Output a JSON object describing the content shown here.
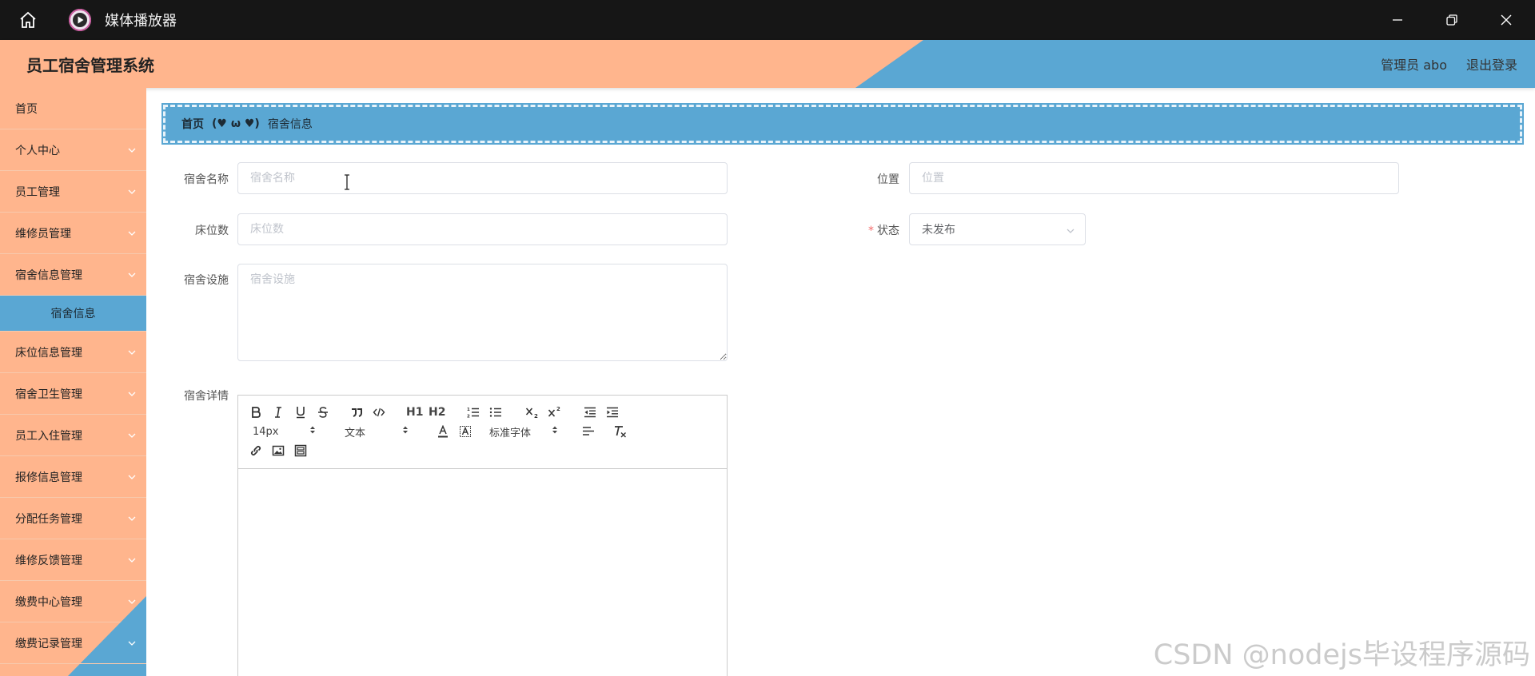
{
  "window": {
    "title": "媒体播放器",
    "icons": {
      "home": "home-icon",
      "app": "play-circle-icon",
      "minimize": "minimize-icon",
      "maximize": "restore-icon",
      "close": "close-icon"
    }
  },
  "header": {
    "title": "员工宿舍管理系统",
    "user_label": "管理员 abo",
    "logout_label": "退出登录",
    "colors": {
      "peach": "#ffb58d",
      "blue": "#5aa7d3"
    }
  },
  "sidebar": {
    "items": [
      {
        "label": "首页",
        "has_arrow": false
      },
      {
        "label": "个人中心",
        "has_arrow": true
      },
      {
        "label": "员工管理",
        "has_arrow": true
      },
      {
        "label": "维修员管理",
        "has_arrow": true
      },
      {
        "label": "宿舍信息管理",
        "has_arrow": true,
        "expanded": true
      },
      {
        "label": "宿舍信息",
        "sub": true,
        "active": true
      },
      {
        "label": "床位信息管理",
        "has_arrow": true
      },
      {
        "label": "宿舍卫生管理",
        "has_arrow": true
      },
      {
        "label": "员工入住管理",
        "has_arrow": true
      },
      {
        "label": "报修信息管理",
        "has_arrow": true
      },
      {
        "label": "分配任务管理",
        "has_arrow": true
      },
      {
        "label": "维修反馈管理",
        "has_arrow": true
      },
      {
        "label": "缴费中心管理",
        "has_arrow": true
      },
      {
        "label": "缴费记录管理",
        "has_arrow": true
      }
    ]
  },
  "breadcrumb": {
    "home": "首页",
    "separator": "(♥ ω ♥)",
    "current": "宿舍信息"
  },
  "form": {
    "dorm_name": {
      "label": "宿舍名称",
      "placeholder": "宿舍名称",
      "value": ""
    },
    "location": {
      "label": "位置",
      "placeholder": "位置",
      "value": ""
    },
    "beds": {
      "label": "床位数",
      "placeholder": "床位数",
      "value": ""
    },
    "status": {
      "label": "状态",
      "required_mark": "*",
      "value": "未发布"
    },
    "facilities": {
      "label": "宿舍设施",
      "placeholder": "宿舍设施",
      "value": ""
    },
    "details": {
      "label": "宿舍详情"
    }
  },
  "editor": {
    "font_size": "14px",
    "text_type": "文本",
    "font_family": "标准字体",
    "h1": "H1",
    "h2": "H2"
  },
  "watermark": "CSDN @nodejs毕设程序源码"
}
